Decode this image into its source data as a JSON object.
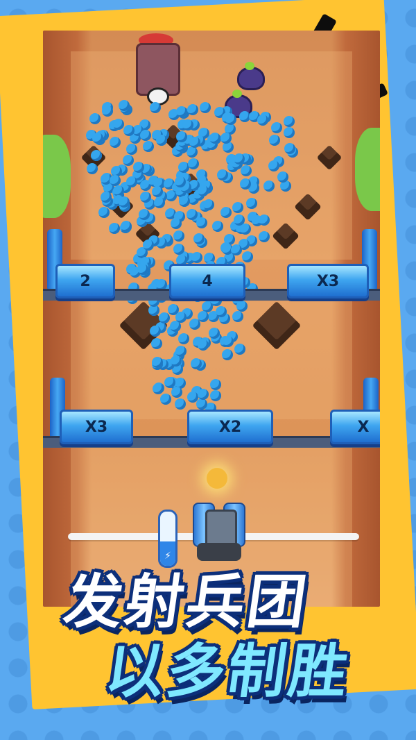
{
  "gates": [
    {
      "label": "2"
    },
    {
      "label": "4"
    },
    {
      "label": "X3"
    },
    {
      "label": "X3"
    },
    {
      "label": "X2"
    },
    {
      "label": "X"
    }
  ],
  "slogan": {
    "line1": "发射兵团",
    "line2": "以多制胜"
  },
  "battery": {
    "level": 0.45
  },
  "colors": {
    "background": "#5aa9f0",
    "card": "#ffc431",
    "crowd": "#35a6ee",
    "gate": "#3fa6f0",
    "slogan_outline": "#0c2f7a"
  },
  "icons": [
    "lightning-icon",
    "cannon-icon",
    "tower-icon",
    "enemy-icon"
  ]
}
